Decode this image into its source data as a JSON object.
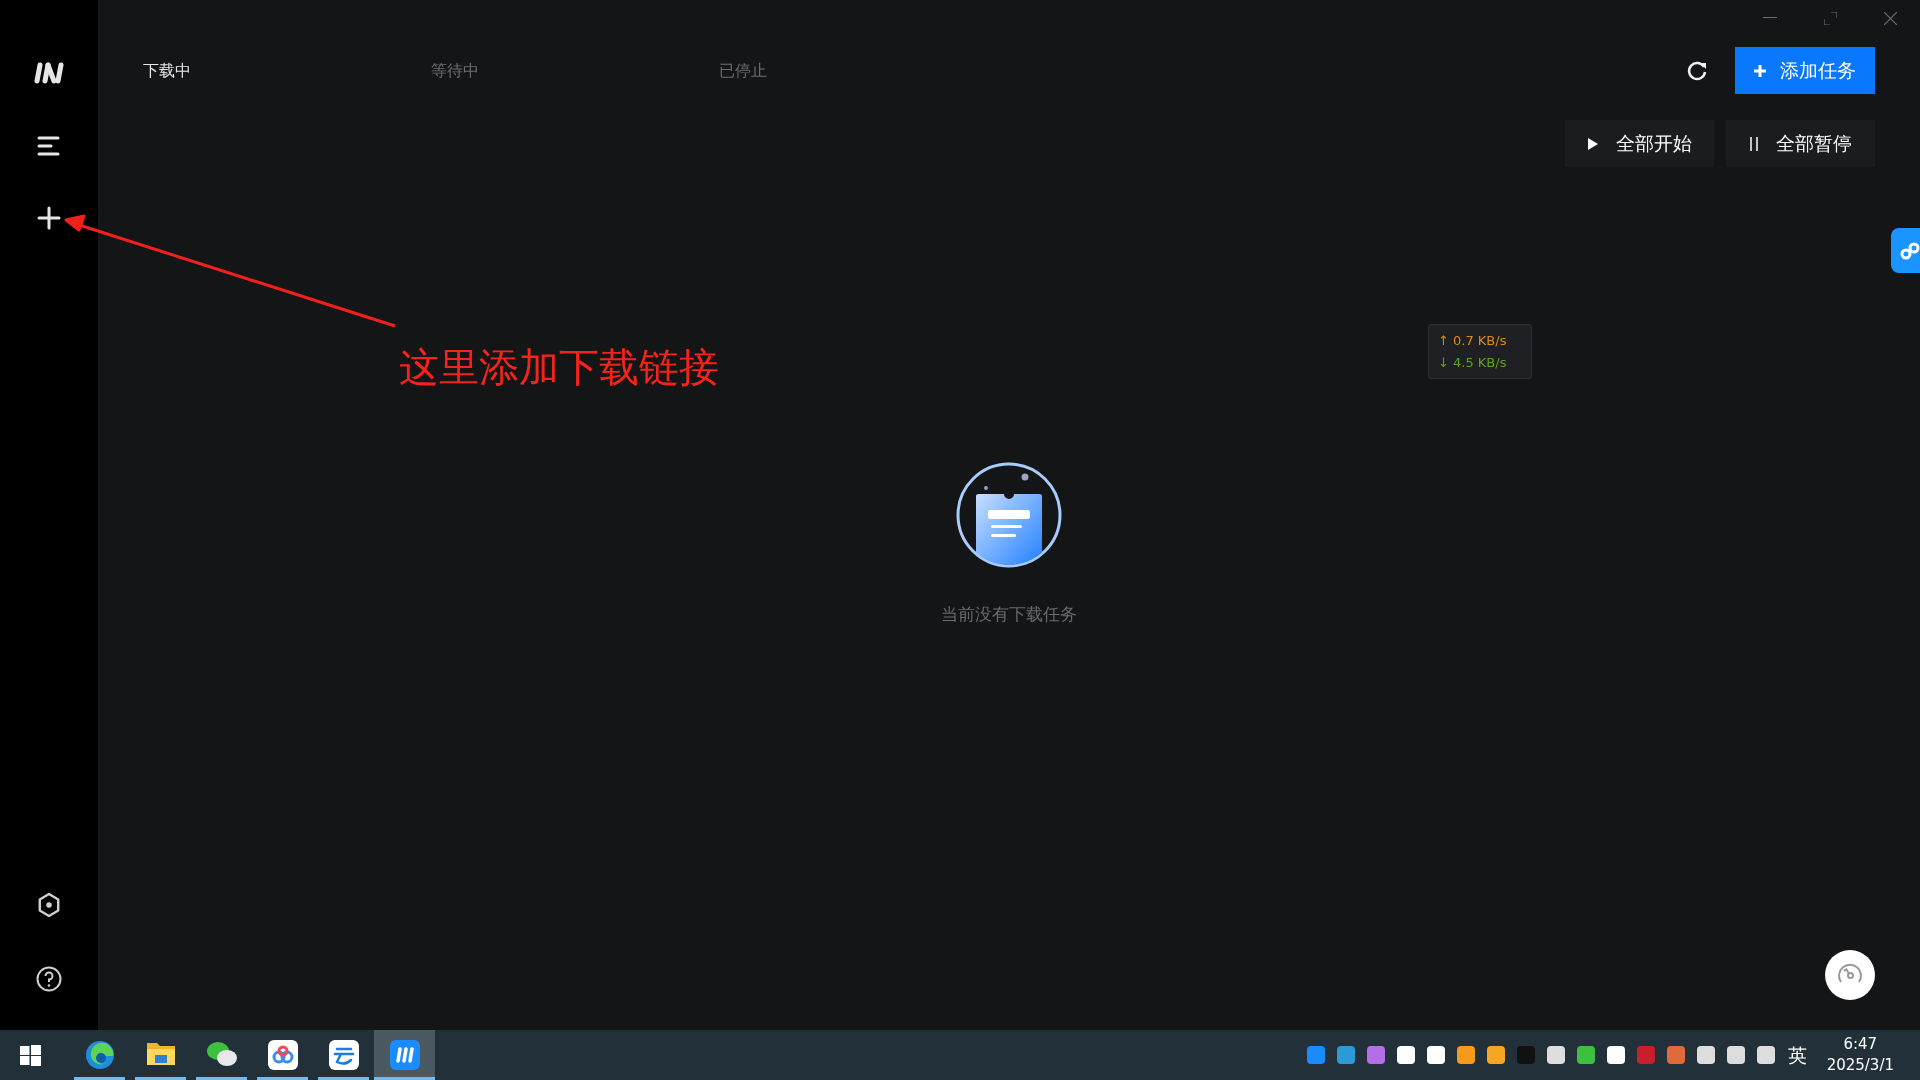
{
  "sidebar": {
    "items": [
      {
        "kind": "menu"
      },
      {
        "kind": "add"
      },
      {
        "kind": "settings"
      },
      {
        "kind": "help"
      }
    ]
  },
  "tabs": [
    {
      "label": "下载中",
      "selected": true
    },
    {
      "label": "等待中",
      "selected": false
    },
    {
      "label": "已停止",
      "selected": false
    }
  ],
  "add_task_button": {
    "label": "添加任务"
  },
  "actions": [
    {
      "kind": "start",
      "label": "全部开始"
    },
    {
      "kind": "pause",
      "label": "全部暂停"
    }
  ],
  "speed": {
    "upload": "↑ 0.7 KB/s",
    "download": "↓ 4.5 KB/s"
  },
  "empty_state": {
    "message": "当前没有下载任务"
  },
  "annotation": {
    "text": "这里添加下载链接"
  },
  "taskbar": {
    "apps": [
      {
        "kind": "browser",
        "selected": false
      },
      {
        "kind": "folder",
        "selected": false
      },
      {
        "kind": "chat",
        "selected": false
      },
      {
        "kind": "cloud",
        "selected": false
      },
      {
        "kind": "cloud-drive",
        "selected": false
      },
      {
        "kind": "downloader",
        "selected": true
      }
    ],
    "input_method": "英",
    "time": "6:47",
    "date": "2025/3/1"
  }
}
